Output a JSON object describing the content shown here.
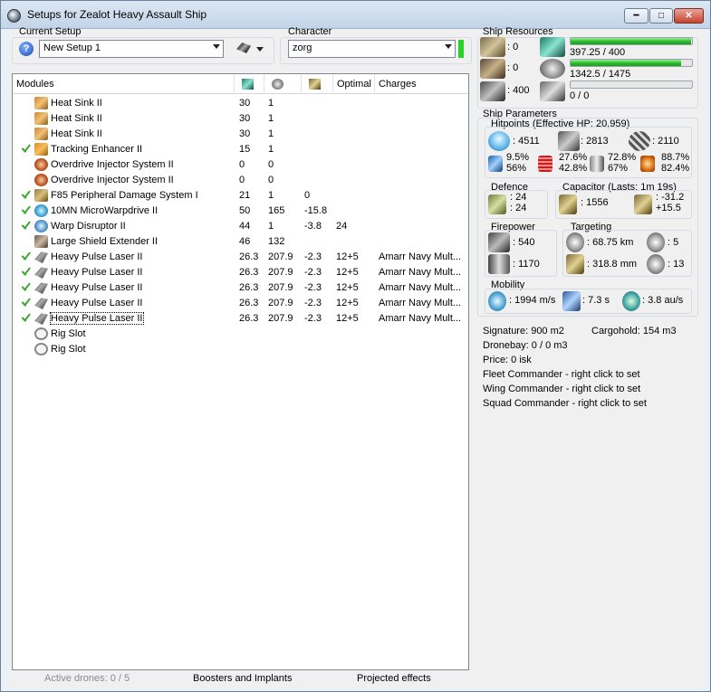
{
  "window": {
    "title": "Setups for Zealot Heavy Assault Ship"
  },
  "current_setup": {
    "label": "Current Setup",
    "value": "New Setup 1"
  },
  "character": {
    "label": "Character",
    "value": "zorg"
  },
  "modules": {
    "headers": {
      "name": "Modules",
      "optimal": "Optimal",
      "charges": "Charges"
    },
    "rows": [
      {
        "checked": false,
        "icon": "heat-sink-icon",
        "name": "Heat Sink II",
        "c1": "30",
        "c2": "1",
        "c3": "",
        "c4": "",
        "c5": ""
      },
      {
        "checked": false,
        "icon": "heat-sink-icon",
        "name": "Heat Sink II",
        "c1": "30",
        "c2": "1",
        "c3": "",
        "c4": "",
        "c5": ""
      },
      {
        "checked": false,
        "icon": "heat-sink-icon",
        "name": "Heat Sink II",
        "c1": "30",
        "c2": "1",
        "c3": "",
        "c4": "",
        "c5": ""
      },
      {
        "checked": true,
        "icon": "tracking-enhancer-icon",
        "name": "Tracking Enhancer II",
        "c1": "15",
        "c2": "1",
        "c3": "",
        "c4": "",
        "c5": ""
      },
      {
        "checked": false,
        "icon": "overdrive-injector-icon",
        "name": "Overdrive Injector System II",
        "c1": "0",
        "c2": "0",
        "c3": "",
        "c4": "",
        "c5": ""
      },
      {
        "checked": false,
        "icon": "overdrive-injector-icon",
        "name": "Overdrive Injector System II",
        "c1": "0",
        "c2": "0",
        "c3": "",
        "c4": "",
        "c5": ""
      },
      {
        "checked": true,
        "icon": "damage-system-icon",
        "name": "F85 Peripheral Damage System I",
        "c1": "21",
        "c2": "1",
        "c3": "0",
        "c4": "",
        "c5": ""
      },
      {
        "checked": true,
        "icon": "microwarpdrive-icon",
        "name": "10MN MicroWarpdrive II",
        "c1": "50",
        "c2": "165",
        "c3": "-15.8",
        "c4": "",
        "c5": ""
      },
      {
        "checked": true,
        "icon": "warp-disruptor-icon",
        "name": "Warp Disruptor II",
        "c1": "44",
        "c2": "1",
        "c3": "-3.8",
        "c4": "24",
        "c5": ""
      },
      {
        "checked": false,
        "icon": "shield-extender-icon",
        "name": "Large Shield Extender II",
        "c1": "46",
        "c2": "132",
        "c3": "",
        "c4": "",
        "c5": ""
      },
      {
        "checked": true,
        "icon": "pulse-laser-icon",
        "name": "Heavy Pulse Laser II",
        "c1": "26.3",
        "c2": "207.9",
        "c3": "-2.3",
        "c4": "12+5",
        "c5": "Amarr Navy Mult..."
      },
      {
        "checked": true,
        "icon": "pulse-laser-icon",
        "name": "Heavy Pulse Laser II",
        "c1": "26.3",
        "c2": "207.9",
        "c3": "-2.3",
        "c4": "12+5",
        "c5": "Amarr Navy Mult..."
      },
      {
        "checked": true,
        "icon": "pulse-laser-icon",
        "name": "Heavy Pulse Laser II",
        "c1": "26.3",
        "c2": "207.9",
        "c3": "-2.3",
        "c4": "12+5",
        "c5": "Amarr Navy Mult..."
      },
      {
        "checked": true,
        "icon": "pulse-laser-icon",
        "name": "Heavy Pulse Laser II",
        "c1": "26.3",
        "c2": "207.9",
        "c3": "-2.3",
        "c4": "12+5",
        "c5": "Amarr Navy Mult..."
      },
      {
        "checked": true,
        "icon": "pulse-laser-icon",
        "name": "Heavy Pulse Laser II",
        "c1": "26.3",
        "c2": "207.9",
        "c3": "-2.3",
        "c4": "12+5",
        "c5": "Amarr Navy Mult..."
      },
      {
        "checked": false,
        "icon": "rig-slot-icon",
        "name": "Rig Slot",
        "c1": "",
        "c2": "",
        "c3": "",
        "c4": "",
        "c5": ""
      },
      {
        "checked": false,
        "icon": "rig-slot-icon",
        "name": "Rig Slot",
        "c1": "",
        "c2": "",
        "c3": "",
        "c4": "",
        "c5": ""
      }
    ]
  },
  "status": {
    "drones": "Active drones: 0 / 5",
    "boosters": "Boosters and Implants",
    "projected": "Projected effects"
  },
  "resources": {
    "label": "Ship Resources",
    "turrets": ": 0",
    "launchers": ": 0",
    "calibration": ": 400",
    "cpu": "397.25 / 400",
    "cpu_fraction": 0.993,
    "powergrid": "1342.5 / 1475",
    "powergrid_fraction": 0.91,
    "drone_bw": "0 / 0",
    "drone_bw_fraction": 0
  },
  "params": {
    "label": "Ship Parameters",
    "hitpoints_label": "Hitpoints (Effective HP: 20,959)",
    "shield_hp": ": 4511",
    "armor_hp": ": 2813",
    "structure_hp": ": 2110",
    "res_em": [
      "9.5%",
      "56%"
    ],
    "res_therm": [
      "27.6%",
      "42.8%"
    ],
    "res_kin": [
      "72.8%",
      "67%"
    ],
    "res_exp": [
      "88.7%",
      "82.4%"
    ],
    "defence_label": "Defence",
    "defence_vals": [
      ": 24",
      ": 24"
    ],
    "capacitor_label": "Capacitor (Lasts: 1m 19s)",
    "cap_amount": ": 1556",
    "cap_vals": [
      ": -31.2",
      "+15.5"
    ],
    "firepower_label": "Firepower",
    "turret_dps": ": 540",
    "missile_dps": ": 1170",
    "targeting_label": "Targeting",
    "target_range": ": 68.75 km",
    "max_targets": ": 5",
    "scan_res": ": 318.8 mm",
    "sensor_str": ": 13",
    "mobility_label": "Mobility",
    "speed": ": 1994 m/s",
    "align": ": 7.3 s",
    "warp": ": 3.8 au/s"
  },
  "info": {
    "signature": "Signature: 900 m2",
    "cargohold": "Cargohold: 154 m3",
    "dronebay": "Dronebay: 0 / 0 m3",
    "price": "Price: 0 isk",
    "fleet": "Fleet Commander - right click to set",
    "wing": "Wing Commander - right click to set",
    "squad": "Squad Commander - right click to set"
  }
}
